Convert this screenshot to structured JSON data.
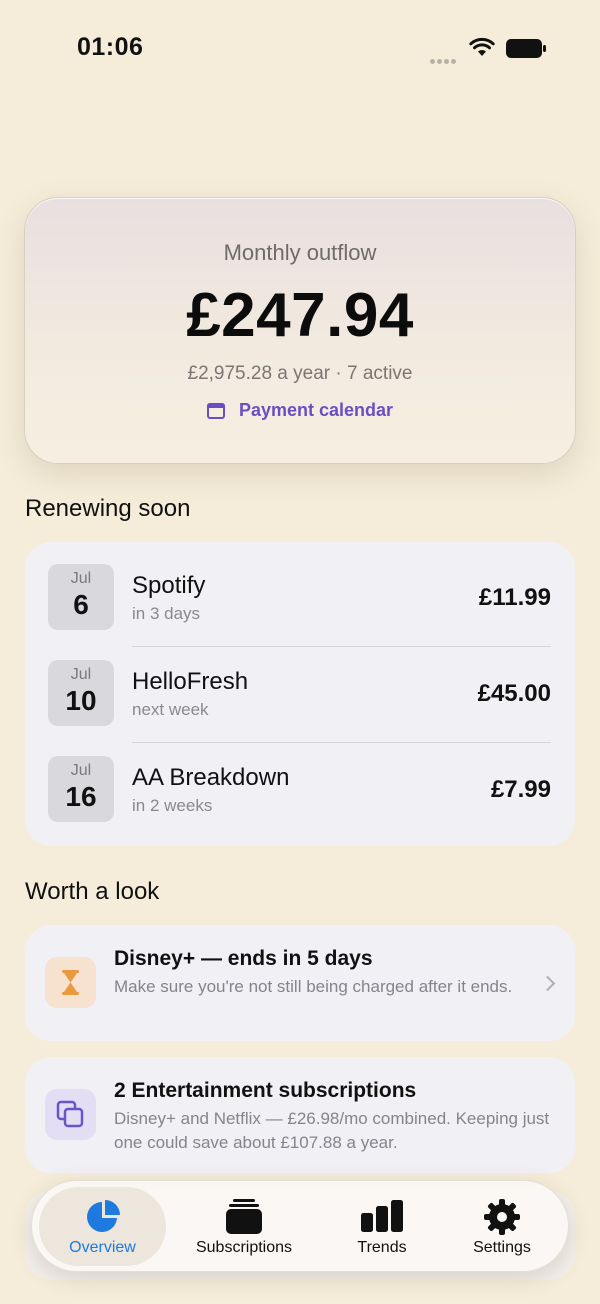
{
  "status_bar": {
    "time": "01:06"
  },
  "hero": {
    "label": "Monthly outflow",
    "amount": "£247.94",
    "subtitle": "£2,975.28 a year · 7 active",
    "link_label": "Payment calendar"
  },
  "renewing": {
    "title": "Renewing soon",
    "items": [
      {
        "month": "Jul",
        "day": "6",
        "name": "Spotify",
        "when": "in 3 days",
        "amount": "£11.99"
      },
      {
        "month": "Jul",
        "day": "10",
        "name": "HelloFresh",
        "when": "next week",
        "amount": "£45.00"
      },
      {
        "month": "Jul",
        "day": "16",
        "name": "AA Breakdown",
        "when": "in 2 weeks",
        "amount": "£7.99"
      }
    ]
  },
  "worth_a_look": {
    "title": "Worth a look",
    "tips": [
      {
        "icon": "hourglass-icon",
        "title": "Disney+ — ends in 5 days",
        "body": "Make sure you're not still being charged after it ends."
      },
      {
        "icon": "stacked-squares-icon",
        "title": "2 Entertainment subscriptions",
        "body": "Disney+ and Netflix — £26.98/mo combined. Keeping just one could save about £107.88 a year."
      }
    ]
  },
  "tab_bar": {
    "selected": "Overview",
    "tabs": [
      {
        "label": "Overview",
        "icon": "pie-chart-icon"
      },
      {
        "label": "Subscriptions",
        "icon": "stack-icon"
      },
      {
        "label": "Trends",
        "icon": "bar-chart-icon"
      },
      {
        "label": "Settings",
        "icon": "gear-icon"
      }
    ]
  },
  "colors": {
    "background": "#f5edd9",
    "accent": "#6a4fc4",
    "tab_selected": "#1f7ae0",
    "card": "#f1f0f5",
    "tip_orange": "#e89a3c",
    "tip_purple": "#6a55c8"
  }
}
